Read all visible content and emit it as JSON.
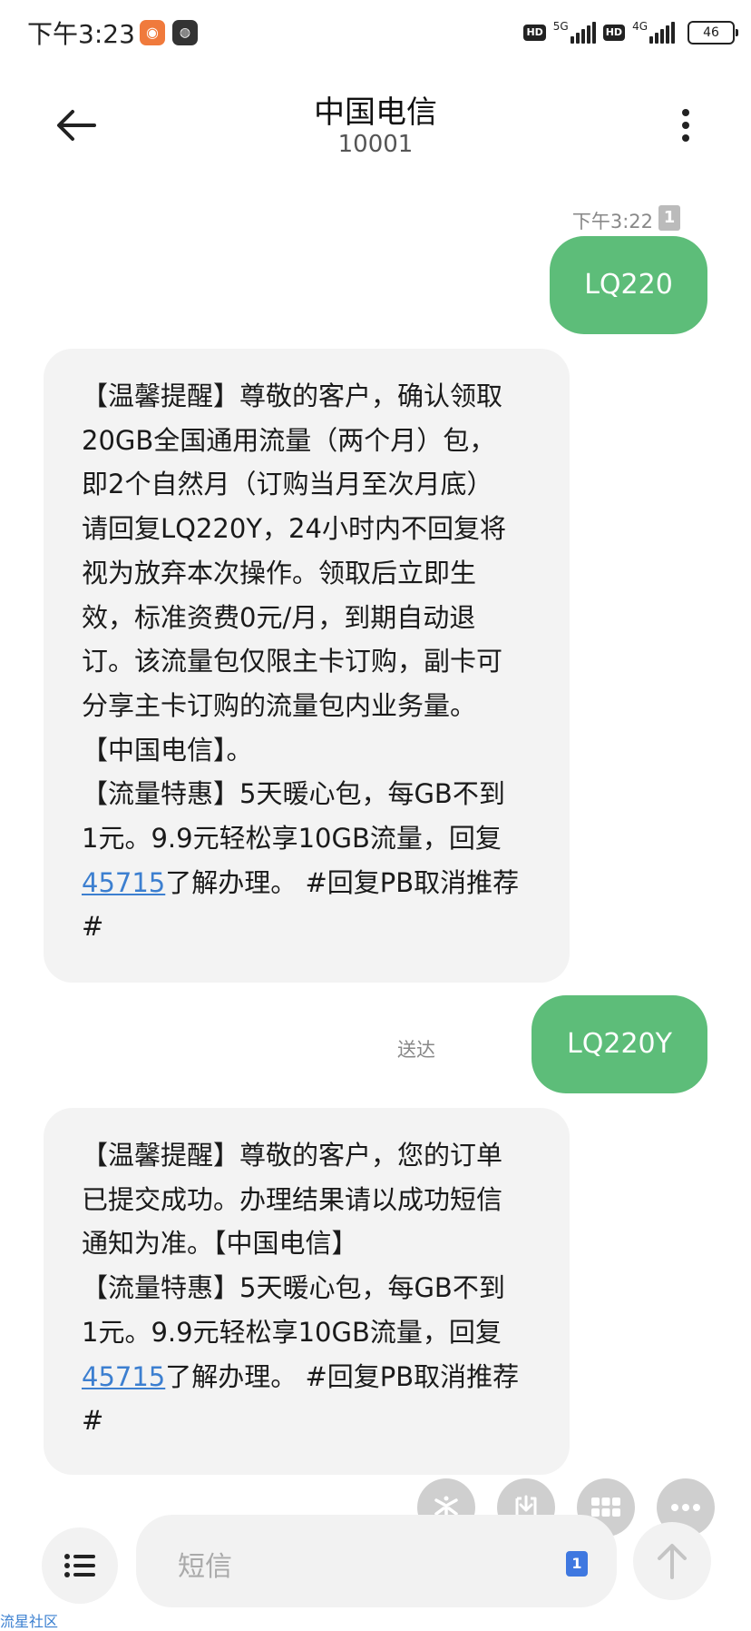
{
  "status_bar": {
    "time": "下午3:23",
    "net1": "5G",
    "net2": "4G",
    "hd": "HD",
    "battery": "46"
  },
  "header": {
    "title": "中国电信",
    "number": "10001"
  },
  "messages": {
    "sent1": {
      "timestamp": "下午3:22",
      "sim": "1",
      "text": "LQ220"
    },
    "recv1": {
      "lines": [
        "【温馨提醒】尊敬的客户，确认领取",
        "20GB全国通用流量（两个月）包，",
        "即2个自然月（订购当月至次月底）",
        "请回复LQ220Y，24小时内不回复将",
        "视为放弃本次操作。领取后立即生",
        "效，标准资费0元/月，到期自动退",
        "订。该流量包仅限主卡订购，副卡可",
        "分享主卡订购的流量包内业务量。",
        "【中国电信】。",
        "【流量特惠】5天暖心包，每GB不到",
        "1元。9.9元轻松享10GB流量，回复"
      ],
      "link": "45715",
      "after_link": "了解办理。 #回复PB取消推荐",
      "last": "#"
    },
    "sent2": {
      "status": "送达",
      "text": "LQ220Y"
    },
    "recv2": {
      "lines": [
        "【温馨提醒】尊敬的客户，您的订单",
        "已提交成功。办理结果请以成功短信",
        "通知为准。【中国电信】",
        "【流量特惠】5天暖心包，每GB不到",
        "1元。9.9元轻松享10GB流量，回复"
      ],
      "link": "45715",
      "after_link": "了解办理。 #回复PB取消推荐",
      "last": "#"
    }
  },
  "composer": {
    "placeholder": "短信",
    "sim": "1"
  },
  "watermark": "流星社区",
  "colors": {
    "outgoing_bubble": "#5dbd79",
    "incoming_bubble": "#f3f3f3",
    "link": "#3c7fd0",
    "sim_badge": "#3f78e0"
  }
}
